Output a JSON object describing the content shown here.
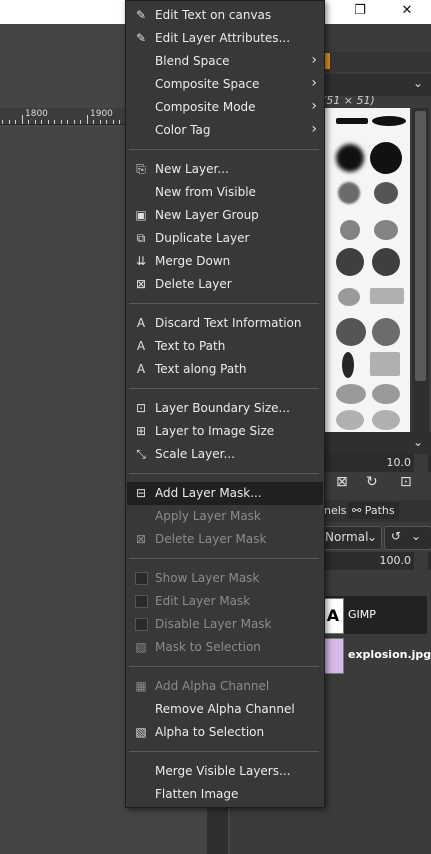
{
  "window": {
    "restore_glyph": "❐",
    "close_glyph": "✕"
  },
  "ruler": {
    "labels": [
      "1800",
      "1900"
    ]
  },
  "brushes_panel": {
    "size_label": "(51 × 51)",
    "spacing_value": "10.0"
  },
  "layers_panel": {
    "tabs": [
      "nels",
      "Paths"
    ],
    "mode": "Normal",
    "opacity": "100.0",
    "layers": [
      {
        "name": "GIMP",
        "thumb_glyph": "A"
      },
      {
        "name": "explosion.jpg"
      }
    ]
  },
  "menu": {
    "groups": [
      [
        {
          "label": "Edit Text on canvas",
          "icon": "edit-text-icon",
          "glyph": "✎",
          "disabled": false
        },
        {
          "label": "Edit Layer Attributes...",
          "icon": "edit-attributes-icon",
          "glyph": "✎",
          "disabled": false
        },
        {
          "label": "Blend Space",
          "submenu": true,
          "disabled": false
        },
        {
          "label": "Composite Space",
          "submenu": true,
          "disabled": false
        },
        {
          "label": "Composite Mode",
          "submenu": true,
          "disabled": false
        },
        {
          "label": "Color Tag",
          "submenu": true,
          "disabled": false
        }
      ],
      [
        {
          "label": "New Layer...",
          "icon": "new-layer-icon",
          "glyph": "⎘",
          "disabled": false
        },
        {
          "label": "New from Visible",
          "disabled": false
        },
        {
          "label": "New Layer Group",
          "icon": "new-layer-group-icon",
          "glyph": "▣",
          "disabled": false
        },
        {
          "label": "Duplicate Layer",
          "icon": "duplicate-layer-icon",
          "glyph": "⧉",
          "disabled": false
        },
        {
          "label": "Merge Down",
          "icon": "merge-down-icon",
          "glyph": "⇊",
          "disabled": false
        },
        {
          "label": "Delete Layer",
          "icon": "delete-layer-icon",
          "glyph": "⊠",
          "disabled": false
        }
      ],
      [
        {
          "label": "Discard Text Information",
          "icon": "text-tool-icon",
          "glyph": "A",
          "disabled": false
        },
        {
          "label": "Text to Path",
          "icon": "text-tool-icon",
          "glyph": "A",
          "disabled": false
        },
        {
          "label": "Text along Path",
          "icon": "text-tool-icon",
          "glyph": "A",
          "disabled": false
        }
      ],
      [
        {
          "label": "Layer Boundary Size...",
          "icon": "boundary-size-icon",
          "glyph": "⊡",
          "disabled": false
        },
        {
          "label": "Layer to Image Size",
          "icon": "layer-to-image-icon",
          "glyph": "⊞",
          "disabled": false
        },
        {
          "label": "Scale Layer...",
          "icon": "scale-layer-icon",
          "glyph": "⤡",
          "disabled": false
        }
      ],
      [
        {
          "label": "Add Layer Mask...",
          "icon": "add-layer-mask-icon",
          "glyph": "⊟",
          "disabled": false,
          "highlighted": true
        },
        {
          "label": "Apply Layer Mask",
          "disabled": true
        },
        {
          "label": "Delete Layer Mask",
          "icon": "delete-mask-icon",
          "glyph": "⊠",
          "disabled": true
        }
      ],
      [
        {
          "label": "Show Layer Mask",
          "checkbox": true,
          "disabled": true
        },
        {
          "label": "Edit Layer Mask",
          "checkbox": true,
          "disabled": true
        },
        {
          "label": "Disable Layer Mask",
          "checkbox": true,
          "disabled": true
        },
        {
          "label": "Mask to Selection",
          "icon": "mask-selection-icon",
          "glyph": "▧",
          "disabled": true
        }
      ],
      [
        {
          "label": "Add Alpha Channel",
          "icon": "alpha-channel-icon",
          "glyph": "▦",
          "disabled": true
        },
        {
          "label": "Remove Alpha Channel",
          "disabled": false
        },
        {
          "label": "Alpha to Selection",
          "icon": "alpha-selection-icon",
          "glyph": "▧",
          "disabled": false
        }
      ],
      [
        {
          "label": "Merge Visible Layers...",
          "disabled": false
        },
        {
          "label": "Flatten Image",
          "disabled": false
        }
      ]
    ]
  }
}
